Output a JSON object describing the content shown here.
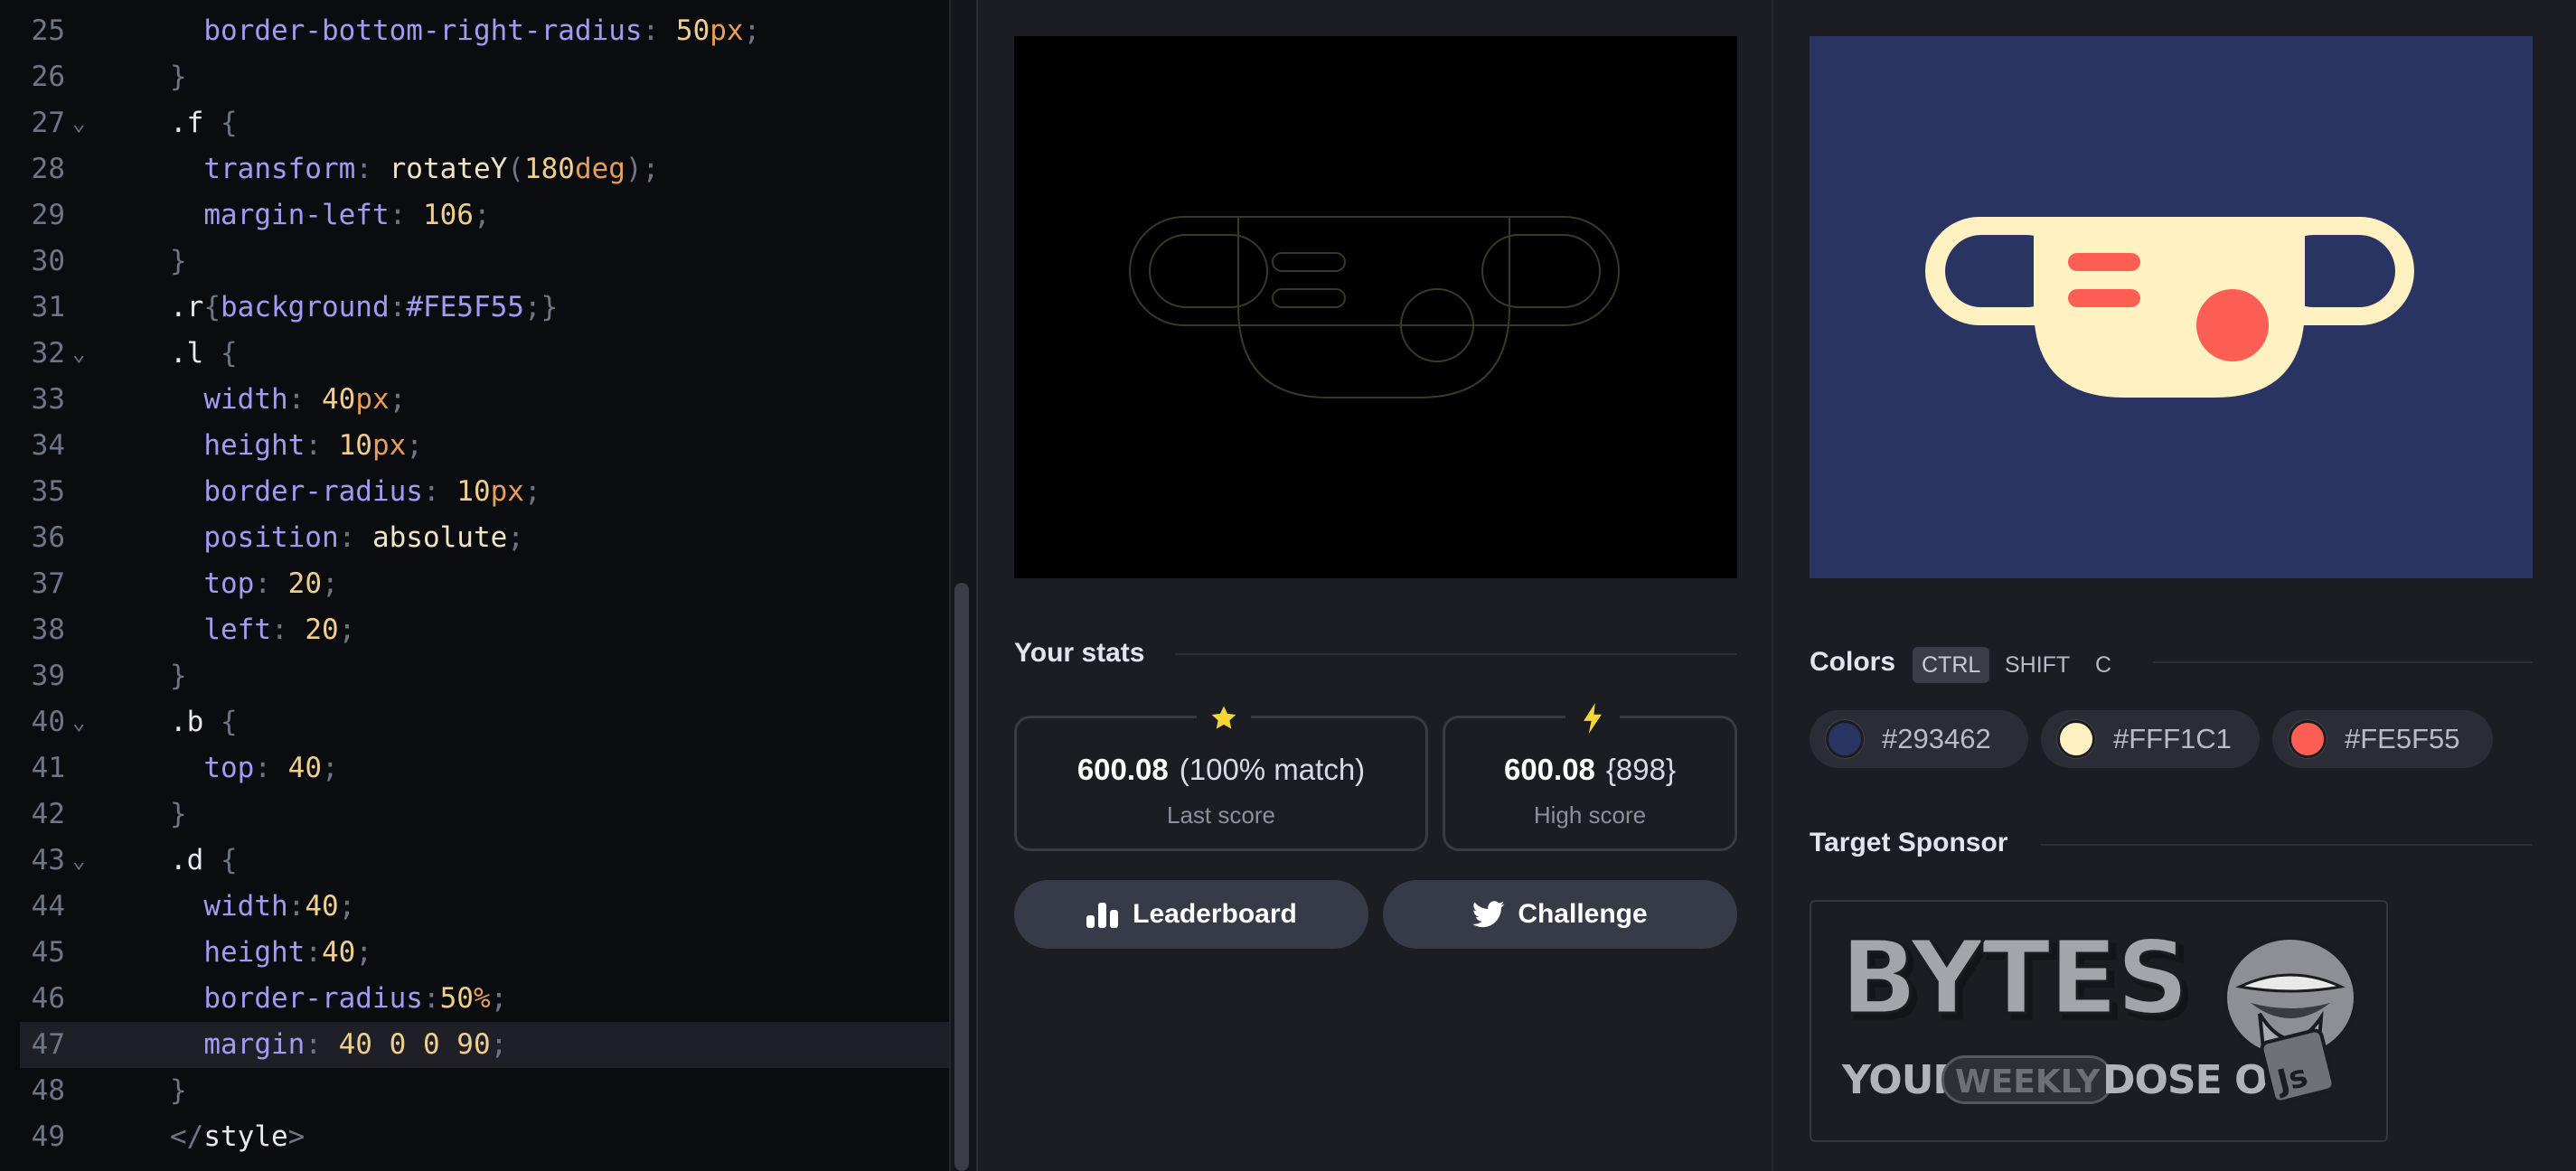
{
  "editor": {
    "lines": [
      {
        "n": "25",
        "fold": "",
        "tokens": [
          {
            "c": "t-prop",
            "t": "  border-bottom-right-radius"
          },
          {
            "c": "t-br",
            "t": ": "
          },
          {
            "c": "t-num",
            "t": "50"
          },
          {
            "c": "t-unit",
            "t": "px"
          },
          {
            "c": "t-br",
            "t": ";"
          }
        ]
      },
      {
        "n": "26",
        "fold": "",
        "tokens": [
          {
            "c": "t-br",
            "t": "}"
          }
        ]
      },
      {
        "n": "27",
        "fold": "⌄",
        "tokens": [
          {
            "c": "t-sel",
            "t": ".f "
          },
          {
            "c": "t-br",
            "t": "{"
          }
        ]
      },
      {
        "n": "28",
        "fold": "",
        "tokens": [
          {
            "c": "t-prop",
            "t": "  transform"
          },
          {
            "c": "t-br",
            "t": ": "
          },
          {
            "c": "t-fn",
            "t": "rotateY"
          },
          {
            "c": "t-br",
            "t": "("
          },
          {
            "c": "t-num",
            "t": "180"
          },
          {
            "c": "t-unit",
            "t": "deg"
          },
          {
            "c": "t-br",
            "t": ");"
          }
        ]
      },
      {
        "n": "29",
        "fold": "",
        "tokens": [
          {
            "c": "t-prop",
            "t": "  margin-left"
          },
          {
            "c": "t-br",
            "t": ": "
          },
          {
            "c": "t-num",
            "t": "106"
          },
          {
            "c": "t-br",
            "t": ";"
          }
        ]
      },
      {
        "n": "30",
        "fold": "",
        "tokens": [
          {
            "c": "t-br",
            "t": "}"
          }
        ]
      },
      {
        "n": "31",
        "fold": "",
        "tokens": [
          {
            "c": "t-sel",
            "t": ".r"
          },
          {
            "c": "t-br",
            "t": "{"
          },
          {
            "c": "t-prop",
            "t": "background"
          },
          {
            "c": "t-br",
            "t": ":"
          },
          {
            "c": "t-prop",
            "t": "#FE5F55"
          },
          {
            "c": "t-br",
            "t": ";}"
          }
        ]
      },
      {
        "n": "32",
        "fold": "⌄",
        "tokens": [
          {
            "c": "t-sel",
            "t": ".l "
          },
          {
            "c": "t-br",
            "t": "{"
          }
        ]
      },
      {
        "n": "33",
        "fold": "",
        "tokens": [
          {
            "c": "t-prop",
            "t": "  width"
          },
          {
            "c": "t-br",
            "t": ": "
          },
          {
            "c": "t-num",
            "t": "40"
          },
          {
            "c": "t-unit",
            "t": "px"
          },
          {
            "c": "t-br",
            "t": ";"
          }
        ]
      },
      {
        "n": "34",
        "fold": "",
        "tokens": [
          {
            "c": "t-prop",
            "t": "  height"
          },
          {
            "c": "t-br",
            "t": ": "
          },
          {
            "c": "t-num",
            "t": "10"
          },
          {
            "c": "t-unit",
            "t": "px"
          },
          {
            "c": "t-br",
            "t": ";"
          }
        ]
      },
      {
        "n": "35",
        "fold": "",
        "tokens": [
          {
            "c": "t-prop",
            "t": "  border-radius"
          },
          {
            "c": "t-br",
            "t": ": "
          },
          {
            "c": "t-num",
            "t": "10"
          },
          {
            "c": "t-unit",
            "t": "px"
          },
          {
            "c": "t-br",
            "t": ";"
          }
        ]
      },
      {
        "n": "36",
        "fold": "",
        "tokens": [
          {
            "c": "t-prop",
            "t": "  position"
          },
          {
            "c": "t-br",
            "t": ": "
          },
          {
            "c": "t-fn",
            "t": "absolute"
          },
          {
            "c": "t-br",
            "t": ";"
          }
        ]
      },
      {
        "n": "37",
        "fold": "",
        "tokens": [
          {
            "c": "t-prop",
            "t": "  top"
          },
          {
            "c": "t-br",
            "t": ": "
          },
          {
            "c": "t-num",
            "t": "20"
          },
          {
            "c": "t-br",
            "t": ";"
          }
        ]
      },
      {
        "n": "38",
        "fold": "",
        "tokens": [
          {
            "c": "t-prop",
            "t": "  left"
          },
          {
            "c": "t-br",
            "t": ": "
          },
          {
            "c": "t-num",
            "t": "20"
          },
          {
            "c": "t-br",
            "t": ";"
          }
        ]
      },
      {
        "n": "39",
        "fold": "",
        "tokens": [
          {
            "c": "t-br",
            "t": "}"
          }
        ]
      },
      {
        "n": "40",
        "fold": "⌄",
        "tokens": [
          {
            "c": "t-sel",
            "t": ".b "
          },
          {
            "c": "t-br",
            "t": "{"
          }
        ]
      },
      {
        "n": "41",
        "fold": "",
        "tokens": [
          {
            "c": "t-prop",
            "t": "  top"
          },
          {
            "c": "t-br",
            "t": ": "
          },
          {
            "c": "t-num",
            "t": "40"
          },
          {
            "c": "t-br",
            "t": ";"
          }
        ]
      },
      {
        "n": "42",
        "fold": "",
        "tokens": [
          {
            "c": "t-br",
            "t": "}"
          }
        ]
      },
      {
        "n": "43",
        "fold": "⌄",
        "tokens": [
          {
            "c": "t-sel",
            "t": ".d "
          },
          {
            "c": "t-br",
            "t": "{"
          }
        ]
      },
      {
        "n": "44",
        "fold": "",
        "tokens": [
          {
            "c": "t-prop",
            "t": "  width"
          },
          {
            "c": "t-br",
            "t": ":"
          },
          {
            "c": "t-num",
            "t": "40"
          },
          {
            "c": "t-br",
            "t": ";"
          }
        ]
      },
      {
        "n": "45",
        "fold": "",
        "tokens": [
          {
            "c": "t-prop",
            "t": "  height"
          },
          {
            "c": "t-br",
            "t": ":"
          },
          {
            "c": "t-num",
            "t": "40"
          },
          {
            "c": "t-br",
            "t": ";"
          }
        ]
      },
      {
        "n": "46",
        "fold": "",
        "tokens": [
          {
            "c": "t-prop",
            "t": "  border-radius"
          },
          {
            "c": "t-br",
            "t": ":"
          },
          {
            "c": "t-num",
            "t": "50"
          },
          {
            "c": "t-unit",
            "t": "%"
          },
          {
            "c": "t-br",
            "t": ";"
          }
        ]
      },
      {
        "n": "47",
        "fold": "",
        "active": true,
        "tokens": [
          {
            "c": "t-prop",
            "t": "  margin"
          },
          {
            "c": "t-br",
            "t": ": "
          },
          {
            "c": "t-num",
            "t": "40 0 0 90"
          },
          {
            "c": "t-br",
            "t": ";"
          }
        ]
      },
      {
        "n": "48",
        "fold": "",
        "tokens": [
          {
            "c": "t-br",
            "t": "}"
          }
        ]
      },
      {
        "n": "49",
        "fold": "",
        "tokens": [
          {
            "c": "t-br",
            "t": "</"
          },
          {
            "c": "t-tag",
            "t": "style"
          },
          {
            "c": "t-br",
            "t": ">"
          }
        ]
      }
    ]
  },
  "stats": {
    "title": "Your stats",
    "last": {
      "value": "600.08",
      "detail": "(100% match)",
      "label": "Last score",
      "icon": "star-icon"
    },
    "high": {
      "value": "600.08",
      "detail": "{898}",
      "label": "High score",
      "icon": "bolt-icon"
    }
  },
  "buttons": {
    "leaderboard": "Leaderboard",
    "challenge": "Challenge"
  },
  "colors_section": {
    "title": "Colors",
    "shortcut": [
      "CTRL",
      "SHIFT",
      "C"
    ],
    "swatches": [
      {
        "hex": "#293462",
        "color": "#293462"
      },
      {
        "hex": "#FFF1C1",
        "color": "#FFF1C1"
      },
      {
        "hex": "#FE5F55",
        "color": "#FE5F55"
      }
    ]
  },
  "sponsor": {
    "title": "Target Sponsor",
    "brand": "BYTES",
    "tagline_1": "YOUR",
    "tagline_2": "WEEKLY",
    "tagline_3": "DOSE OF",
    "badge": "Js"
  },
  "theme": {
    "target_bg": "#293462",
    "target_fg": "#FFF1C1",
    "target_accent": "#FE5F55"
  }
}
